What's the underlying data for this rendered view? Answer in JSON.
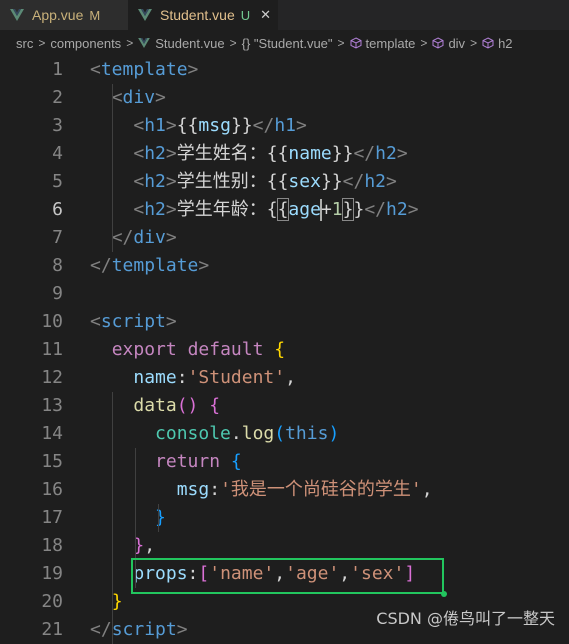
{
  "tabs": [
    {
      "label": "App.vue",
      "status": "M",
      "active": false
    },
    {
      "label": "Student.vue",
      "status": "U",
      "active": true,
      "close": "✕"
    }
  ],
  "breadcrumb": {
    "items": [
      "src",
      "components",
      "Student.vue",
      "{} \"Student.vue\"",
      "template",
      "div",
      "h2"
    ],
    "separator": ">"
  },
  "editor": {
    "active_line": 6,
    "lines": [
      {
        "n": "1",
        "tokens": [
          [
            "br",
            "<"
          ],
          [
            "tag",
            "template"
          ],
          [
            "br",
            ">"
          ]
        ]
      },
      {
        "n": "2",
        "tokens": [
          [
            "txt",
            "  "
          ],
          [
            "br",
            "<"
          ],
          [
            "tag",
            "div"
          ],
          [
            "br",
            ">"
          ]
        ]
      },
      {
        "n": "3",
        "tokens": [
          [
            "txt",
            "    "
          ],
          [
            "br",
            "<"
          ],
          [
            "tag",
            "h1"
          ],
          [
            "br",
            ">"
          ],
          [
            "txt",
            "{{"
          ],
          [
            "prop",
            "msg"
          ],
          [
            "txt",
            "}}"
          ],
          [
            "br",
            "</"
          ],
          [
            "tag",
            "h1"
          ],
          [
            "br",
            ">"
          ]
        ]
      },
      {
        "n": "4",
        "tokens": [
          [
            "txt",
            "    "
          ],
          [
            "br",
            "<"
          ],
          [
            "tag",
            "h2"
          ],
          [
            "br",
            ">"
          ],
          [
            "txt",
            "学生姓名："
          ],
          [
            "txt",
            "{{"
          ],
          [
            "prop",
            "name"
          ],
          [
            "txt",
            "}}"
          ],
          [
            "br",
            "</"
          ],
          [
            "tag",
            "h2"
          ],
          [
            "br",
            ">"
          ]
        ]
      },
      {
        "n": "5",
        "tokens": [
          [
            "txt",
            "    "
          ],
          [
            "br",
            "<"
          ],
          [
            "tag",
            "h2"
          ],
          [
            "br",
            ">"
          ],
          [
            "txt",
            "学生性别："
          ],
          [
            "txt",
            "{{"
          ],
          [
            "prop",
            "sex"
          ],
          [
            "txt",
            "}}"
          ],
          [
            "br",
            "</"
          ],
          [
            "tag",
            "h2"
          ],
          [
            "br",
            ">"
          ]
        ]
      },
      {
        "n": "6",
        "tokens": [
          [
            "txt",
            "    "
          ],
          [
            "br",
            "<"
          ],
          [
            "tag",
            "h2"
          ],
          [
            "br",
            ">"
          ],
          [
            "txt",
            "学生年龄："
          ],
          [
            "txt",
            "{"
          ],
          [
            "bm",
            "{"
          ],
          [
            "prop",
            "age"
          ],
          [
            "cursor",
            ""
          ],
          [
            "txt",
            "+"
          ],
          [
            "num",
            "1"
          ],
          [
            "bm",
            "}"
          ],
          [
            "txt",
            "}"
          ],
          [
            "br",
            "</"
          ],
          [
            "tag",
            "h2"
          ],
          [
            "br",
            ">"
          ]
        ]
      },
      {
        "n": "7",
        "tokens": [
          [
            "txt",
            "  "
          ],
          [
            "br",
            "</"
          ],
          [
            "tag",
            "div"
          ],
          [
            "br",
            ">"
          ]
        ]
      },
      {
        "n": "8",
        "tokens": [
          [
            "br",
            "</"
          ],
          [
            "tag",
            "template"
          ],
          [
            "br",
            ">"
          ]
        ]
      },
      {
        "n": "9",
        "tokens": []
      },
      {
        "n": "10",
        "tokens": [
          [
            "br",
            "<"
          ],
          [
            "tag",
            "script"
          ],
          [
            "br",
            ">"
          ]
        ]
      },
      {
        "n": "11",
        "tokens": [
          [
            "txt",
            "  "
          ],
          [
            "kw",
            "export"
          ],
          [
            "txt",
            " "
          ],
          [
            "kw",
            "default"
          ],
          [
            "txt",
            " "
          ],
          [
            "yel",
            "{"
          ]
        ]
      },
      {
        "n": "12",
        "tokens": [
          [
            "txt",
            "    "
          ],
          [
            "prop",
            "name"
          ],
          [
            "txt",
            ":"
          ],
          [
            "str",
            "'Student'"
          ],
          [
            "txt",
            ","
          ]
        ]
      },
      {
        "n": "13",
        "tokens": [
          [
            "txt",
            "    "
          ],
          [
            "fn",
            "data"
          ],
          [
            "pur",
            "()"
          ],
          [
            "txt",
            " "
          ],
          [
            "pur",
            "{"
          ]
        ]
      },
      {
        "n": "14",
        "tokens": [
          [
            "txt",
            "      "
          ],
          [
            "cls",
            "console"
          ],
          [
            "txt",
            "."
          ],
          [
            "fn",
            "log"
          ],
          [
            "blu",
            "("
          ],
          [
            "kw2",
            "this"
          ],
          [
            "blu",
            ")"
          ]
        ]
      },
      {
        "n": "15",
        "tokens": [
          [
            "txt",
            "      "
          ],
          [
            "kw",
            "return"
          ],
          [
            "txt",
            " "
          ],
          [
            "blu",
            "{"
          ]
        ]
      },
      {
        "n": "16",
        "tokens": [
          [
            "txt",
            "        "
          ],
          [
            "prop",
            "msg"
          ],
          [
            "txt",
            ":"
          ],
          [
            "str",
            "'我是一个尚硅谷的学生'"
          ],
          [
            "txt",
            ","
          ]
        ]
      },
      {
        "n": "17",
        "tokens": [
          [
            "txt",
            "      "
          ],
          [
            "blu",
            "}"
          ]
        ]
      },
      {
        "n": "18",
        "tokens": [
          [
            "txt",
            "    "
          ],
          [
            "pur",
            "}"
          ],
          [
            "txt",
            ","
          ]
        ]
      },
      {
        "n": "19",
        "tokens": [
          [
            "txt",
            "    "
          ],
          [
            "prop",
            "props"
          ],
          [
            "txt",
            ":"
          ],
          [
            "pur",
            "["
          ],
          [
            "str",
            "'name'"
          ],
          [
            "txt",
            ","
          ],
          [
            "str",
            "'age'"
          ],
          [
            "txt",
            ","
          ],
          [
            "str",
            "'sex'"
          ],
          [
            "pur",
            "]"
          ]
        ]
      },
      {
        "n": "20",
        "tokens": [
          [
            "txt",
            "  "
          ],
          [
            "yel",
            "}"
          ]
        ]
      },
      {
        "n": "21",
        "tokens": [
          [
            "br",
            "</"
          ],
          [
            "tag",
            "script"
          ],
          [
            "br",
            ">"
          ]
        ]
      }
    ]
  },
  "watermark": "CSDN @倦鸟叫了一整天",
  "colors": {
    "highlight_box": "#22c55e",
    "tag": "#569cd6",
    "string": "#ce9178",
    "property": "#9cdcfe"
  }
}
